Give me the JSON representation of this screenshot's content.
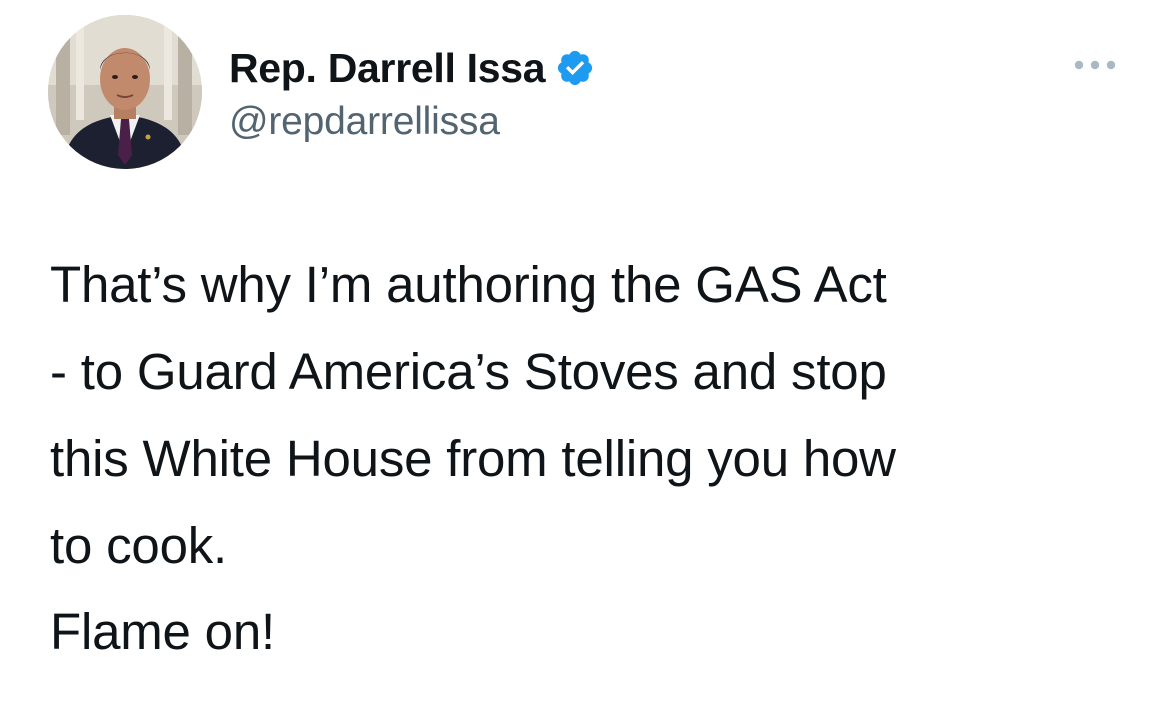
{
  "author": {
    "display_name": "Rep. Darrell Issa",
    "handle": "@repdarrellissa",
    "verified_color": "#1d9bf0",
    "avatar_icon": "profile-photo"
  },
  "menu": {
    "more_icon": "ellipsis-icon",
    "icon_color": "#aab8c2"
  },
  "tweet": {
    "lines": [
      "That’s why I’m authoring the GAS Act",
      "- to Guard America’s Stoves and stop",
      "this White House from telling you how",
      "to cook."
    ],
    "closing": "Flame on!"
  }
}
